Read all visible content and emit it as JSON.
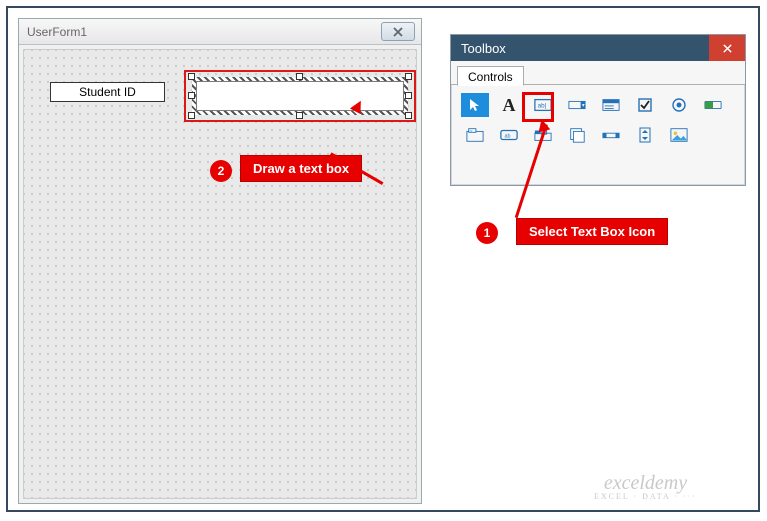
{
  "userform": {
    "title": "UserForm1",
    "label_text": "Student ID"
  },
  "toolbox": {
    "title": "Toolbox",
    "tab_label": "Controls",
    "tools_row1": [
      "select",
      "label",
      "textbox",
      "combobox",
      "listbox",
      "checkbox",
      "optionbutton",
      "togglebutton"
    ],
    "tools_row2": [
      "frame",
      "commandbutton",
      "tabstrip",
      "multipage",
      "scrollbar",
      "spinbutton",
      "image"
    ]
  },
  "callouts": {
    "step1_num": "1",
    "step1_text": "Select Text Box Icon",
    "step2_num": "2",
    "step2_text": "Draw a text box"
  },
  "watermark": {
    "main": "exceldemy",
    "sub": "EXCEL · DATA · ···"
  }
}
